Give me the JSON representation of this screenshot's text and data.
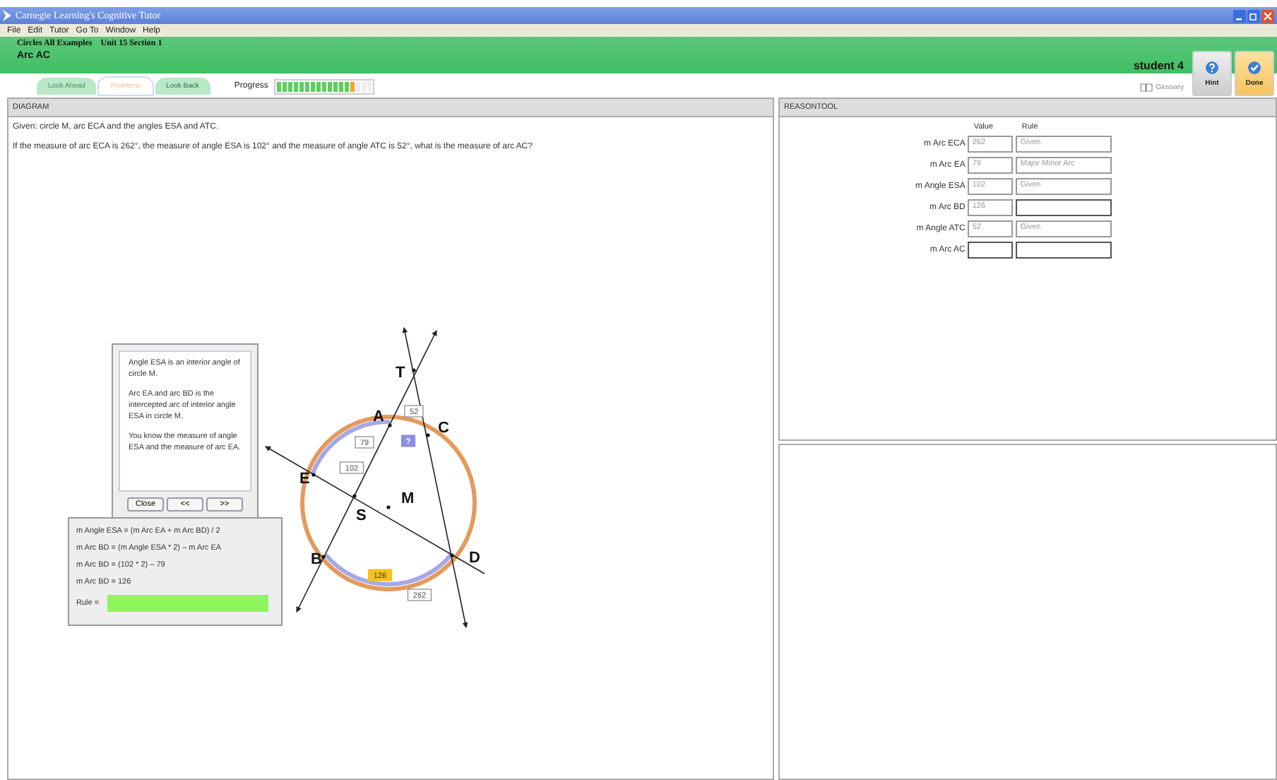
{
  "window": {
    "title": "Carnegie Learning's Cognitive Tutor"
  },
  "menu": [
    "File",
    "Edit",
    "Tutor",
    "Go To",
    "Window",
    "Help"
  ],
  "header": {
    "course": "Circles All Examples",
    "unit": "Unit 15 Section 1",
    "problem": "Arc AC",
    "student": "student 4"
  },
  "tabs": [
    {
      "label": "Look Ahead",
      "selected": false
    },
    {
      "label": "Problems",
      "selected": true
    },
    {
      "label": "Look Back",
      "selected": false
    }
  ],
  "progress": {
    "label": "Progress",
    "level": 0.82
  },
  "glossary": "Glossary",
  "buttons": [
    {
      "kind": "hint",
      "label": "Hint"
    },
    {
      "kind": "done",
      "label": "Done"
    }
  ],
  "diagram": {
    "title": "DIAGRAM",
    "given": "Given: circle M, arc ECA and the angles ESA and ATC.",
    "question": "If the measure of arc ECA is 262°, the measure of angle ESA is 102° and the measure of angle ATC is 52°, what is the measure of arc AC?",
    "points": [
      "T",
      "A",
      "C",
      "E",
      "M",
      "S",
      "B",
      "D"
    ],
    "measures": [
      {
        "text": "52",
        "kind": "given"
      },
      {
        "text": "79",
        "kind": "given"
      },
      {
        "text": "?",
        "kind": "unknown"
      },
      {
        "text": "102",
        "kind": "given"
      },
      {
        "text": "126",
        "kind": "found"
      },
      {
        "text": "262",
        "kind": "given"
      }
    ],
    "hint": {
      "paragraphs": [
        "Angle ESA is an interior angle of circle M.",
        "Arc EA and arc BD is the intercepted arc of interior angle ESA in circle M.",
        "You know the measure of angle ESA and the measure of arc EA."
      ],
      "buttons": [
        "Close",
        "<<",
        ">>"
      ]
    },
    "solver": {
      "lines": [
        "m Angle ESA = (m Arc EA + m Arc BD) / 2",
        "m Arc BD = (m Angle ESA * 2) – m Arc EA",
        "m Arc BD = (102 * 2) – 79",
        "m Arc BD = 126"
      ],
      "rule_label": "Rule =",
      "rule_highlighted": true
    }
  },
  "reasontool": {
    "title": "REASONTOOL",
    "columns": [
      "Value",
      "Rule"
    ],
    "rows": [
      {
        "label": "m Arc ECA",
        "value": {
          "text": "262",
          "locked": true
        },
        "rule": {
          "text": "Given",
          "locked": true
        }
      },
      {
        "label": "m Arc EA",
        "value": {
          "text": "79",
          "locked": true
        },
        "rule": {
          "text": "Major Minor Arc",
          "locked": true
        }
      },
      {
        "label": "m Angle ESA",
        "value": {
          "text": "102",
          "locked": true
        },
        "rule": {
          "text": "Given",
          "locked": true
        }
      },
      {
        "label": "m Arc BD",
        "value": {
          "text": "126",
          "locked": true
        },
        "rule": {
          "locked": false
        }
      },
      {
        "label": "m Angle ATC",
        "value": {
          "text": "52",
          "locked": true
        },
        "rule": {
          "text": "Given",
          "locked": true
        }
      },
      {
        "label": "m Arc AC",
        "value": {
          "locked": false
        },
        "rule": {
          "locked": false
        }
      }
    ]
  }
}
